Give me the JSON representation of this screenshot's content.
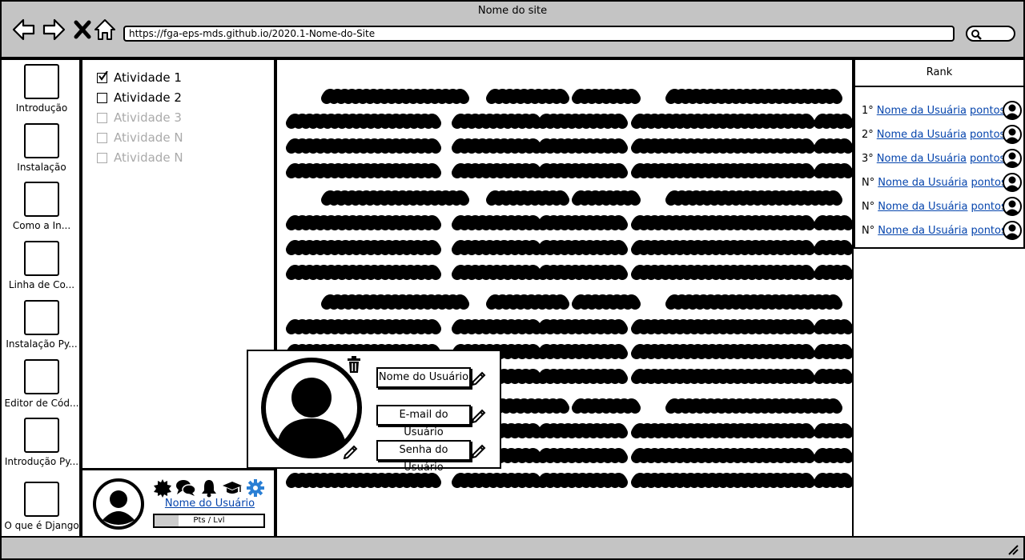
{
  "window": {
    "title": "Nome do site",
    "url": "https://fga-eps-mds.github.io/2020.1-Nome-do-Site"
  },
  "nav": {
    "icons": [
      "arrow-left-icon",
      "arrow-right-icon",
      "close-icon",
      "home-icon",
      "search-icon"
    ]
  },
  "sidebar": {
    "items": [
      {
        "label": "Introdução"
      },
      {
        "label": "Instalação"
      },
      {
        "label": "Como a In..."
      },
      {
        "label": "Linha de Co..."
      },
      {
        "label": "Instalação Py..."
      },
      {
        "label": "Editor de Cód..."
      },
      {
        "label": "Introdução Py..."
      },
      {
        "label": "O que é Django"
      }
    ]
  },
  "activities": [
    {
      "label": "Atividade 1",
      "checked": true,
      "enabled": true
    },
    {
      "label": "Atividade 2",
      "checked": false,
      "enabled": true
    },
    {
      "label": "Atividade 3",
      "checked": false,
      "enabled": false
    },
    {
      "label": "Atividade N",
      "checked": false,
      "enabled": false
    },
    {
      "label": "Atividade N",
      "checked": false,
      "enabled": false
    }
  ],
  "profile": {
    "username": "Nome do Usuário",
    "pts_label": "Pts / Lvl",
    "icons": [
      "badge-icon",
      "chat-icon",
      "bell-icon",
      "graduation-cap-icon",
      "gear-icon"
    ],
    "gear_color": "#2a7fd4"
  },
  "rank": {
    "title": "Rank",
    "rows": [
      {
        "pos": "1°",
        "name": "Nome da Usuária",
        "points": "pontos"
      },
      {
        "pos": "2°",
        "name": "Nome da Usuária",
        "points": "pontos"
      },
      {
        "pos": "3°",
        "name": "Nome da Usuária",
        "points": "pontos"
      },
      {
        "pos": "N°",
        "name": "Nome da Usuária",
        "points": "pontos"
      },
      {
        "pos": "N°",
        "name": "Nome da Usuária",
        "points": "pontos"
      },
      {
        "pos": "N°",
        "name": "Nome da Usuária",
        "points": "pontos"
      }
    ]
  },
  "popup": {
    "fields": [
      {
        "label": "Nome do Usuário"
      },
      {
        "label": "E-mail do Usuário"
      },
      {
        "label": "Senha do Usuário"
      }
    ]
  }
}
